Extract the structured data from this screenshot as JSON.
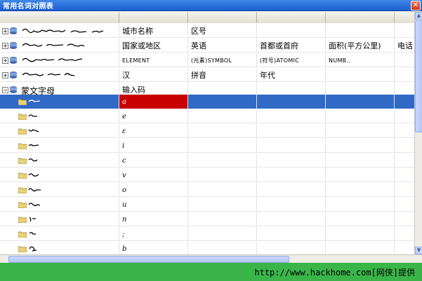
{
  "window": {
    "title": "常用名词对照表",
    "close_label": "✕"
  },
  "tree": {
    "rows": [
      {
        "label_image": "mongolian-script",
        "cells": [
          "城市名称",
          "区号",
          "",
          "",
          ""
        ]
      },
      {
        "label_image": "mongolian-script",
        "cells": [
          "国家或地区",
          "英语",
          "首都或首府",
          "面积(平方公里)",
          "电话"
        ]
      },
      {
        "label_image": "mongolian-script",
        "cells": [
          "ELEMENT",
          "(元素)SYMBOL",
          "(符号)ATOMIC",
          "NUMB..",
          ""
        ]
      },
      {
        "label_image": "mongolian-script",
        "cells": [
          "汉",
          "拼音",
          "年代",
          "",
          ""
        ]
      },
      {
        "label": "蒙文字母",
        "cells": [
          "输入码",
          "",
          "",
          "",
          ""
        ]
      }
    ],
    "children": [
      {
        "code": "a",
        "selected": true
      },
      {
        "code": "e",
        "selected": false
      },
      {
        "code": "ε",
        "selected": false
      },
      {
        "code": "i",
        "selected": false
      },
      {
        "code": "c",
        "selected": false
      },
      {
        "code": "v",
        "selected": false
      },
      {
        "code": "o",
        "selected": false
      },
      {
        "code": "u",
        "selected": false
      },
      {
        "code": "n",
        "selected": false
      },
      {
        "code": ";",
        "selected": false
      },
      {
        "code": "b",
        "selected": false
      }
    ]
  },
  "footer": {
    "watermark": "http://www.hackhome.com[网侠]提供"
  },
  "colors": {
    "titlebar": "#1c5fd0",
    "selection": "#3169c6",
    "selected_code_cell": "#c80000",
    "footer_bg": "#3ab54a"
  }
}
